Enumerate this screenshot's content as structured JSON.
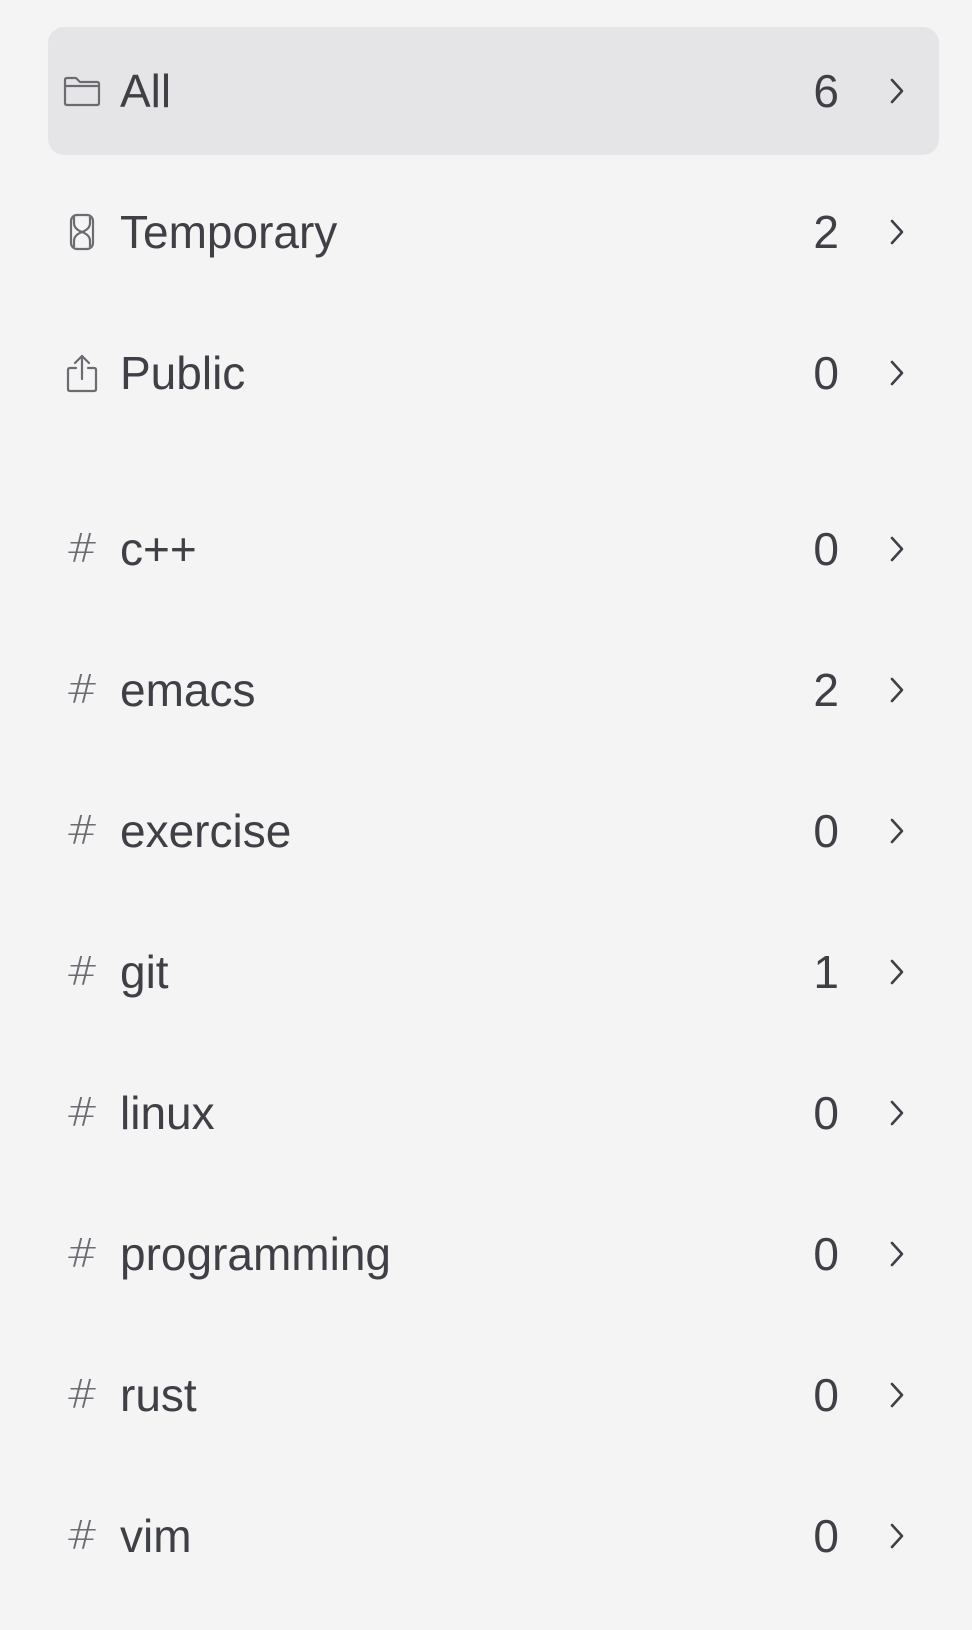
{
  "sidebar": {
    "items": [
      {
        "label": "All",
        "count": "6",
        "icon": "folder-icon",
        "selected": true
      },
      {
        "label": "Temporary",
        "count": "2",
        "icon": "hourglass-icon",
        "selected": false
      },
      {
        "label": "Public",
        "count": "0",
        "icon": "share-icon",
        "selected": false
      }
    ],
    "tag_symbol": "#",
    "tags": [
      {
        "label": "c++",
        "count": "0"
      },
      {
        "label": "emacs",
        "count": "2"
      },
      {
        "label": "exercise",
        "count": "0"
      },
      {
        "label": "git",
        "count": "1"
      },
      {
        "label": "linux",
        "count": "0"
      },
      {
        "label": "programming",
        "count": "0"
      },
      {
        "label": "rust",
        "count": "0"
      },
      {
        "label": "vim",
        "count": "0"
      }
    ]
  },
  "colors": {
    "background": "#f4f4f5",
    "selected_background": "#e5e5e8",
    "text": "#3f3f46",
    "icon": "#6b6b72"
  }
}
